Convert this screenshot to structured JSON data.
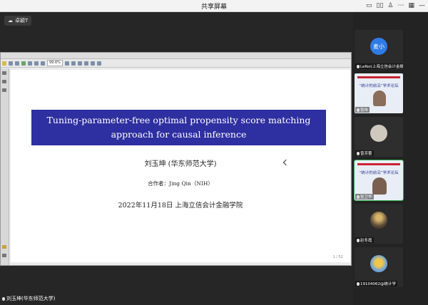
{
  "window": {
    "title": "共享屏幕"
  },
  "tray_icons": [
    "window-icon",
    "tile-icon",
    "person-icon",
    "ellipsis-icon",
    "grid-icon",
    "minimize-icon"
  ],
  "presenter": {
    "label": "卓颖T"
  },
  "viewer": {
    "zoom": "99.6%",
    "page_indicator": "1 / 52"
  },
  "slide": {
    "title_line1": "Tuning-parameter-free optimal propensity score matching",
    "title_line2": "approach for causal inference",
    "author": "刘玉坤 (华东师范大学)",
    "coauthor": "合作者：Jing Qin（NIH）",
    "date_venue": "2022年11月18日    上海立信会计金融学院"
  },
  "local_user": {
    "label": "刘玉坤(华东师范大学)"
  },
  "participants": [
    {
      "name": "LeRoi(上海立信会计金融学院)",
      "avatar_text": "麦小",
      "avatar_color": "#2f7be6",
      "kind": "avatar"
    },
    {
      "name": "张伟",
      "banner_text": "“统计的前沿”学术论坛",
      "kind": "video-banner"
    },
    {
      "name": "曾芳蕾",
      "kind": "video-dark"
    },
    {
      "name": "张卫华",
      "banner_text": "“统计的前沿”学术论坛",
      "kind": "video-banner"
    },
    {
      "name": "赵冬霞",
      "kind": "video-dark"
    },
    {
      "name": "19104062@统计学",
      "kind": "avatar-image"
    }
  ],
  "colors": {
    "title_bg": "#2e2fa0",
    "avatar_blue": "#2f7be6"
  }
}
